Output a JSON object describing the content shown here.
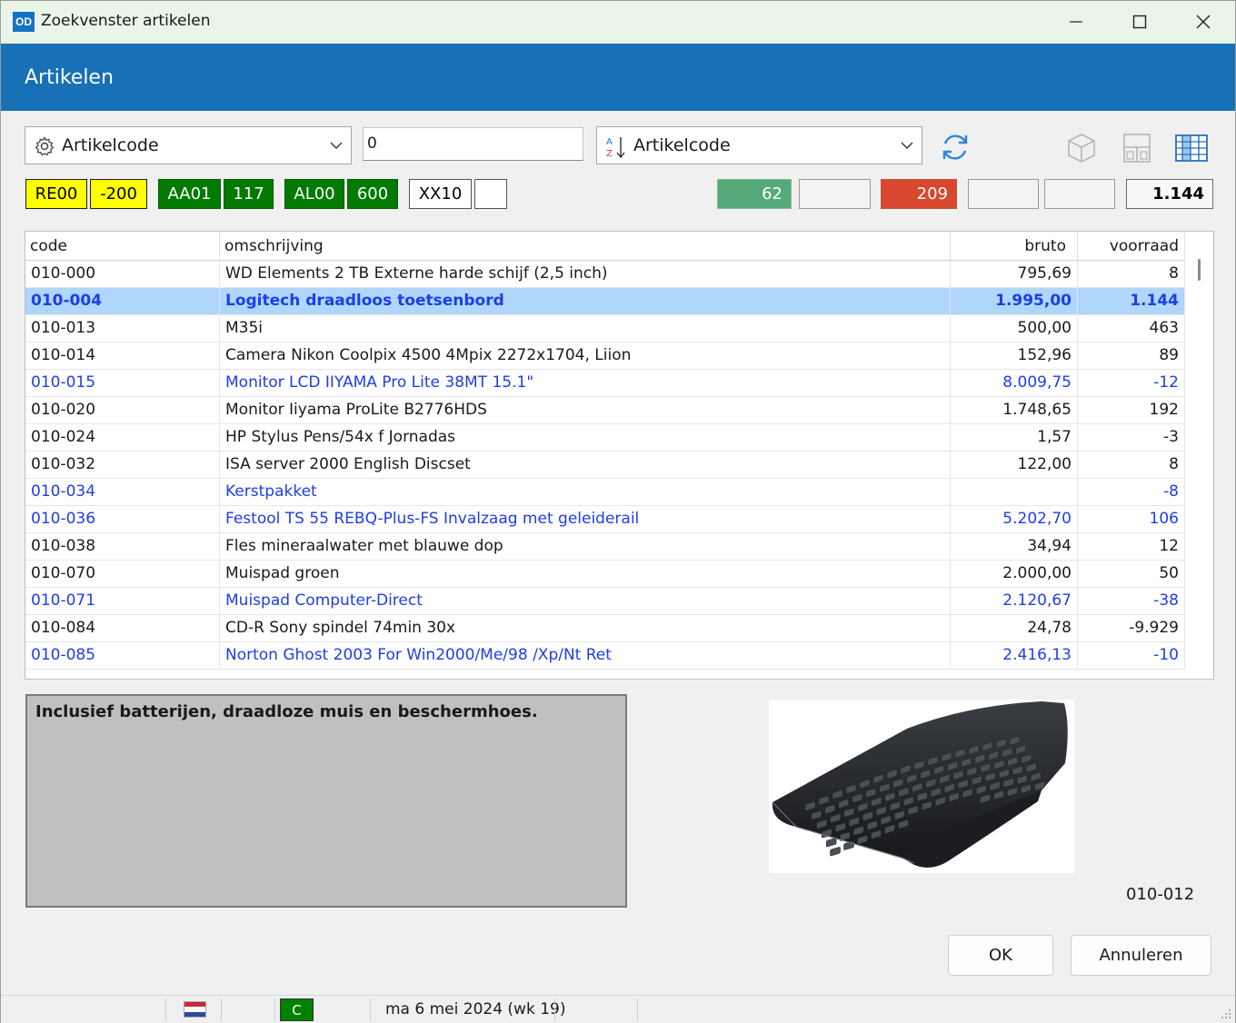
{
  "window": {
    "logo": "OD",
    "title": "Zoekvenster artikelen"
  },
  "header": {
    "title": "Artikelen"
  },
  "toolbar": {
    "search_field_combo": "Artikelcode",
    "search_value": "0",
    "sort_combo": "Artikelcode"
  },
  "badges": [
    {
      "label": "RE00",
      "style": "yellow"
    },
    {
      "label": "-200",
      "style": "yellow"
    },
    {
      "label": "AA01",
      "style": "green"
    },
    {
      "label": "117",
      "style": "green"
    },
    {
      "label": "AL00",
      "style": "green"
    },
    {
      "label": "600",
      "style": "green"
    },
    {
      "label": "XX10",
      "style": "white"
    },
    {
      "label": "",
      "style": "white"
    }
  ],
  "stats": [
    {
      "value": "62",
      "style": "green"
    },
    {
      "value": "",
      "style": "grey"
    },
    {
      "value": "209",
      "style": "red"
    },
    {
      "value": "",
      "style": "grey"
    },
    {
      "value": "",
      "style": "grey"
    },
    {
      "value": "1.144",
      "style": "white"
    }
  ],
  "table": {
    "columns": [
      "code",
      "omschrijving",
      "bruto",
      "voorraad"
    ],
    "rows": [
      {
        "code": "010-000",
        "omschrijving": "WD Elements 2 TB Externe harde schijf (2,5 inch)",
        "bruto": "795,69",
        "voorraad": "8",
        "state": "normal"
      },
      {
        "code": "010-004",
        "omschrijving": "Logitech draadloos toetsenbord",
        "bruto": "1.995,00",
        "voorraad": "1.144",
        "state": "selected"
      },
      {
        "code": "010-013",
        "omschrijving": "M35i",
        "bruto": "500,00",
        "voorraad": "463",
        "state": "normal"
      },
      {
        "code": "010-014",
        "omschrijving": "Camera Nikon Coolpix 4500 4Mpix 2272x1704, Liion",
        "bruto": "152,96",
        "voorraad": "89",
        "state": "normal"
      },
      {
        "code": "010-015",
        "omschrijving": "Monitor LCD IIYAMA Pro Lite 38MT 15.1\"",
        "bruto": "8.009,75",
        "voorraad": "-12",
        "state": "blue"
      },
      {
        "code": "010-020",
        "omschrijving": "Monitor Iiyama ProLite B2776HDS",
        "bruto": "1.748,65",
        "voorraad": "192",
        "state": "normal"
      },
      {
        "code": "010-024",
        "omschrijving": "HP Stylus Pens/54x f Jornadas",
        "bruto": "1,57",
        "voorraad": "-3",
        "state": "normal"
      },
      {
        "code": "010-032",
        "omschrijving": "ISA server 2000 English Discset",
        "bruto": "122,00",
        "voorraad": "8",
        "state": "normal"
      },
      {
        "code": "010-034",
        "omschrijving": "Kerstpakket",
        "bruto": "",
        "voorraad": "-8",
        "state": "blue"
      },
      {
        "code": "010-036",
        "omschrijving": "Festool TS 55 REBQ-Plus-FS Invalzaag met geleiderail",
        "bruto": "5.202,70",
        "voorraad": "106",
        "state": "blue"
      },
      {
        "code": "010-038",
        "omschrijving": "Fles mineraalwater met blauwe dop",
        "bruto": "34,94",
        "voorraad": "12",
        "state": "normal"
      },
      {
        "code": "010-070",
        "omschrijving": "Muispad groen",
        "bruto": "2.000,00",
        "voorraad": "50",
        "state": "normal"
      },
      {
        "code": "010-071",
        "omschrijving": "Muispad Computer-Direct",
        "bruto": "2.120,67",
        "voorraad": "-38",
        "state": "blue"
      },
      {
        "code": "010-084",
        "omschrijving": "CD-R Sony spindel 74min 30x",
        "bruto": "24,78",
        "voorraad": "-9.929",
        "state": "normal"
      },
      {
        "code": "010-085",
        "omschrijving": "Norton Ghost 2003 For Win2000/Me/98 /Xp/Nt Ret",
        "bruto": "2.416,13",
        "voorraad": "-10",
        "state": "blue"
      }
    ]
  },
  "memo": {
    "text": "Inclusief batterijen, draadloze muis en beschermhoes."
  },
  "picture": {
    "code": "010-012"
  },
  "buttons": {
    "ok": "OK",
    "cancel": "Annuleren"
  },
  "statusbar": {
    "company_letter": "C",
    "date": "ma 6 mei 2024 (wk 19)"
  },
  "colors": {
    "header": "#1870b6",
    "selected_row": "#b0d6fb",
    "blue_text": "#1e3ee6",
    "badge_yellow": "#ffff00",
    "badge_green": "#007a00",
    "stat_green": "#55a978",
    "stat_red": "#d8472e"
  }
}
